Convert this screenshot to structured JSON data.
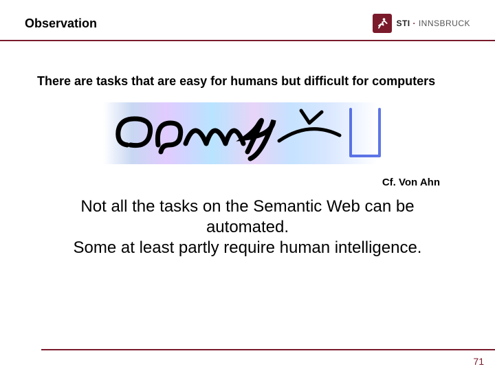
{
  "header": {
    "title": "Observation",
    "logo": {
      "brand": "STI",
      "separator": "·",
      "location": "INNSBRUCK"
    }
  },
  "headline": "There are tasks that are easy for humans but difficult for computers",
  "captcha_text": "0ang",
  "citation": "Cf. Von Ahn",
  "body_line1": "Not all the tasks on the Semantic Web can be automated.",
  "body_line2": "Some at least partly require human intelligence.",
  "page_number": "71",
  "colors": {
    "accent": "#7a1a2b"
  }
}
